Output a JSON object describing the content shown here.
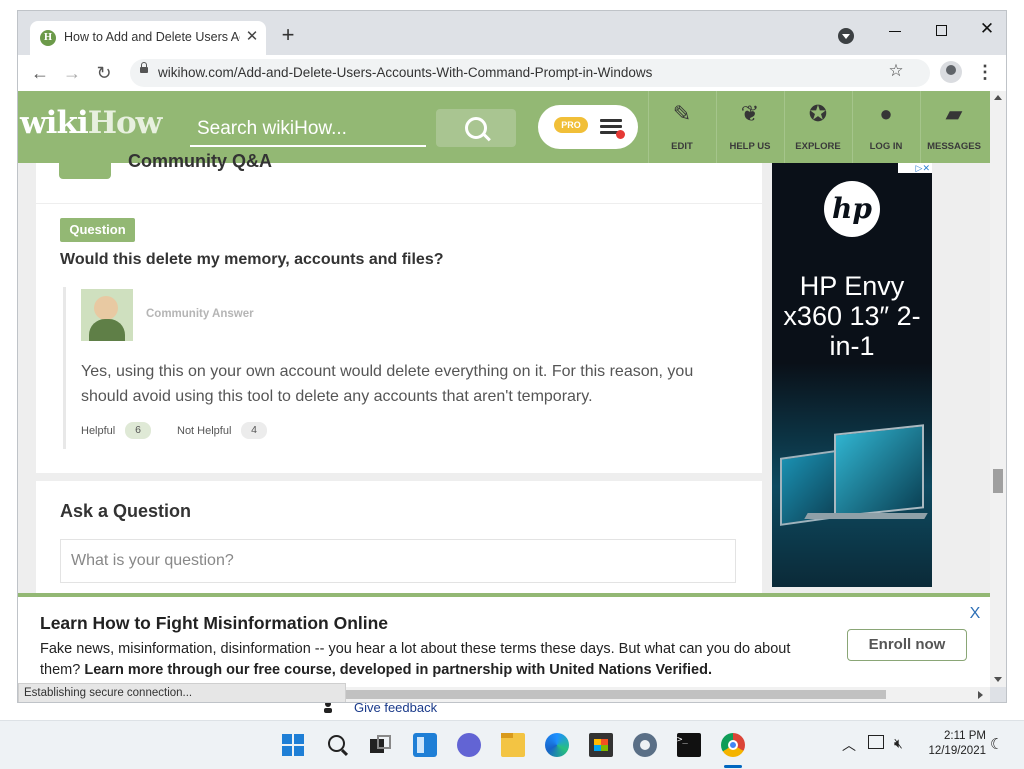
{
  "browser": {
    "tab_title": "How to Add and Delete Users Ac",
    "tab_favicon_letter": "H",
    "url": "wikihow.com/Add-and-Delete-Users-Accounts-With-Command-Prompt-in-Windows",
    "status_text": "Establishing secure connection..."
  },
  "wikihow": {
    "logo_wiki": "wiki",
    "logo_how": "How",
    "search_placeholder": "Search wikiHow...",
    "pro_badge": "PRO",
    "nav": [
      {
        "label": "EDIT",
        "icon": "pencil-icon"
      },
      {
        "label": "HELP US",
        "icon": "sprout-icon"
      },
      {
        "label": "EXPLORE",
        "icon": "compass-icon"
      },
      {
        "label": "LOG IN",
        "icon": "user-icon"
      },
      {
        "label": "MESSAGES",
        "icon": "chat-bubble-icon"
      }
    ]
  },
  "qa": {
    "section_title": "Community Q&A",
    "question_badge": "Question",
    "question": "Would this delete my memory, accounts and files?",
    "answer_author": "Community Answer",
    "answer": "Yes, using this on your own account would delete everything on it. For this reason, you should avoid using this tool to delete any accounts that aren't temporary.",
    "helpful_label": "Helpful",
    "helpful_count": "6",
    "not_helpful_label": "Not Helpful",
    "not_helpful_count": "4",
    "ask_title": "Ask a Question",
    "ask_placeholder": "What is your question?"
  },
  "ad": {
    "brand": "hp",
    "headline": "HP Envy x360 13″ 2-in-1"
  },
  "banner": {
    "title": "Learn How to Fight Misinformation Online",
    "body": "Fake news, misinformation, disinformation -- you hear a lot about these terms these days. But what can you do about them?",
    "body_bold": "Learn more through our free course, developed in partnership with United Nations Verified.",
    "button": "Enroll now",
    "close": "X"
  },
  "desktop": {
    "feedback_link": "Give feedback"
  },
  "taskbar": {
    "time": "2:11 PM",
    "date": "12/19/2021",
    "icons": [
      "start-icon",
      "search-icon",
      "task-view-icon",
      "widgets-icon",
      "chat-icon",
      "file-explorer-icon",
      "edge-icon",
      "store-icon",
      "settings-icon",
      "terminal-icon",
      "chrome-icon"
    ]
  },
  "colors": {
    "wikihow_green": "#93b874",
    "link_blue": "#2d6fb6"
  }
}
